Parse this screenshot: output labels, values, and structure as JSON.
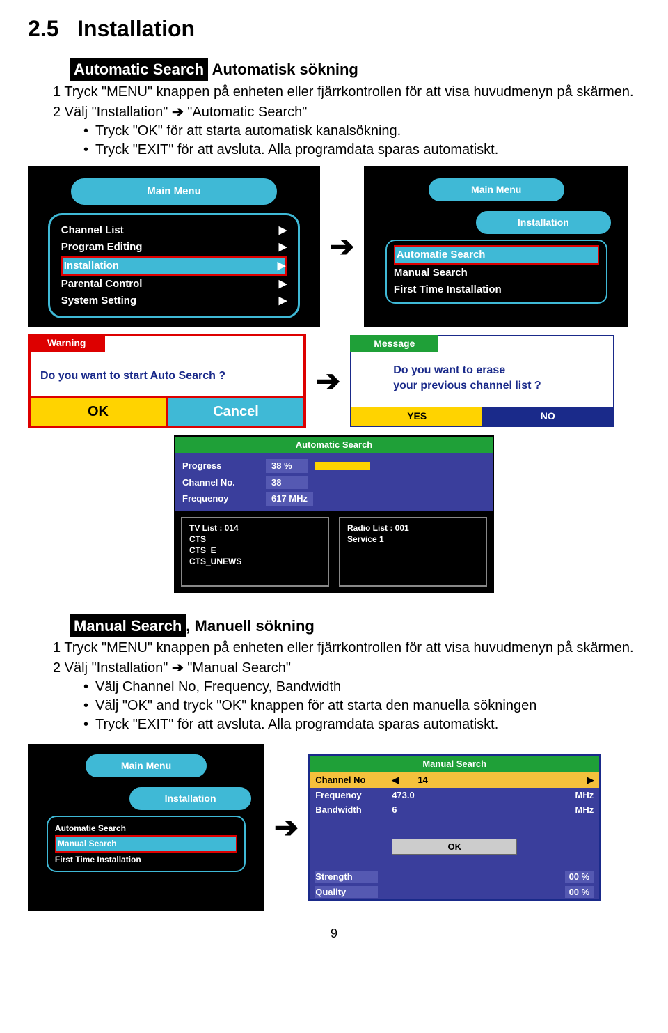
{
  "section": {
    "num": "2.5",
    "title": "Installation"
  },
  "auto": {
    "heading_box": "Automatic Search",
    "heading_rest": " Automatisk sökning",
    "step1": "1 Tryck \"MENU\" knappen på enheten eller fjärrkontrollen för att visa huvudmenyn på skärmen.",
    "step2_prefix": "2 Välj \"Installation\" ",
    "step2_suffix": " \"Automatic Search\"",
    "bullet1": "Tryck \"OK\" för att starta automatisk kanalsökning.",
    "bullet2": "Tryck \"EXIT\" för att avsluta. Alla programdata sparas automatiskt."
  },
  "main_menu": {
    "title": "Main Menu",
    "items": [
      "Channel List",
      "Program Editing",
      "Installation",
      "Parental Control",
      "System Setting"
    ]
  },
  "install_menu": {
    "top": "Main Menu",
    "title": "Installation",
    "items": [
      "Automatie Search",
      "Manual Search",
      "First Time Installation"
    ]
  },
  "warning": {
    "tab": "Warning",
    "text": "Do you want to start Auto Search ?",
    "ok": "OK",
    "cancel": "Cancel"
  },
  "message": {
    "tab": "Message",
    "line1": "Do you want to erase",
    "line2": "your previous channel list ?",
    "yes": "YES",
    "no": "NO"
  },
  "auto_search_screen": {
    "title": "Automatic Search",
    "progress_lbl": "Progress",
    "progress_val": "38 %",
    "channel_lbl": "Channel No.",
    "channel_val": "38",
    "freq_lbl": "Frequenoy",
    "freq_val": "617 MHz",
    "tv_header": "TV List :   014",
    "tv_items": [
      "CTS",
      "CTS_E",
      "CTS_UNEWS"
    ],
    "radio_header": "Radio List :   001",
    "radio_items": [
      "Service 1"
    ]
  },
  "manual": {
    "heading_box": "Manual Search",
    "heading_rest": ", Manuell sökning",
    "step1": "1 Tryck \"MENU\" knappen på enheten eller fjärrkontrollen för att visa huvudmenyn på skärmen.",
    "step2_prefix": "2 Välj \"Installation\" ",
    "step2_suffix": " \"Manual Search\"",
    "bullet1": "Välj Channel No, Frequency, Bandwidth",
    "bullet2": "Välj \"OK\" and tryck \"OK\" knappen för att starta den manuella sökningen",
    "bullet3": "Tryck \"EXIT\" för att avsluta. Alla programdata sparas automatiskt."
  },
  "manual_search_screen": {
    "title": "Manual Search",
    "channel_lbl": "Channel No",
    "channel_val": "14",
    "freq_lbl": "Frequenoy",
    "freq_val": "473.0",
    "freq_unit": "MHz",
    "bw_lbl": "Bandwidth",
    "bw_val": "6",
    "bw_unit": "MHz",
    "ok": "OK",
    "strength_lbl": "Strength",
    "strength_val": "00 %",
    "quality_lbl": "Quality",
    "quality_val": "00 %"
  },
  "arrow": "➔",
  "triangle": "▶",
  "tri_left": "◀",
  "page_num": "9"
}
